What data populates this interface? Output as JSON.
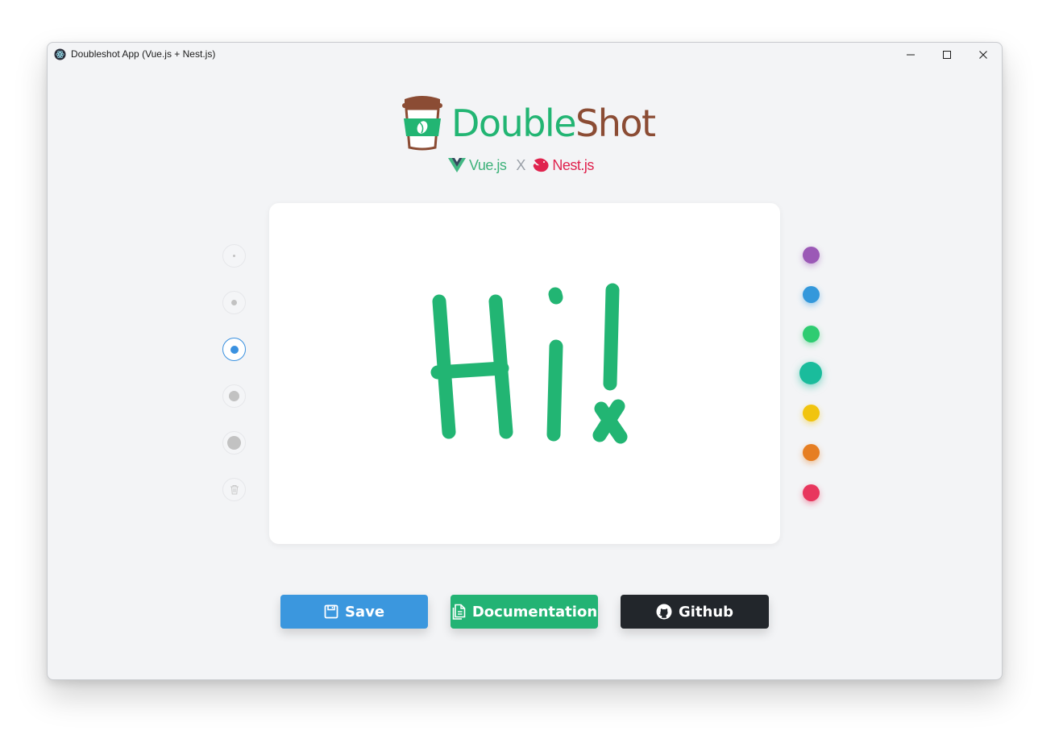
{
  "window": {
    "title": "Doubleshot App (Vue.js + Nest.js)",
    "controls": [
      "minimize-icon",
      "maximize-icon",
      "close-icon"
    ]
  },
  "header": {
    "logo_part1": "Double",
    "logo_part2": "Shot",
    "logo_color1": "#22b573",
    "logo_color2": "#8b4c34",
    "frameworks": {
      "left": "Vue.js",
      "separator": "X",
      "right": "Nest.js"
    }
  },
  "canvas": {
    "drawn_text": "Hi!",
    "stroke_color": "#22b573"
  },
  "brush_sizes": {
    "selected_index": 2,
    "options": [
      "size-1",
      "size-2",
      "size-3",
      "size-4",
      "size-5"
    ],
    "clear_icon": "trash-icon"
  },
  "palette": {
    "selected_index": 3,
    "colors": [
      "#9b59b6",
      "#3498db",
      "#2ecc71",
      "#1abc9c",
      "#f1c40f",
      "#e67e22",
      "#e8365d"
    ]
  },
  "actions": {
    "save_label": "Save",
    "docs_label": "Documentation",
    "github_label": "Github"
  }
}
